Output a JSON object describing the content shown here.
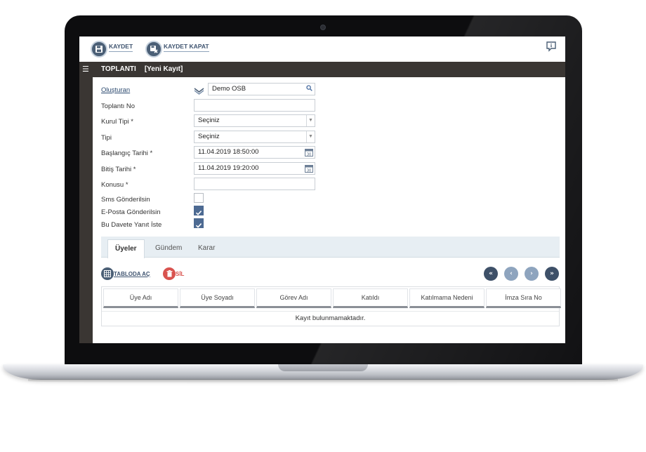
{
  "toolbar": {
    "save_label": "KAYDET",
    "save_close_label": "KAYDET KAPAT"
  },
  "title": {
    "main": "TOPLANTI",
    "sub": "[Yeni Kayıt]"
  },
  "form": {
    "olusturan_label": "Oluşturan",
    "olusturan_value": "Demo OSB",
    "toplanti_no_label": "Toplantı No",
    "toplanti_no_value": "",
    "kurul_tipi_label": "Kurul Tipi *",
    "kurul_tipi_value": "Seçiniz",
    "tipi_label": "Tipi",
    "tipi_value": "Seçiniz",
    "baslangic_label": "Başlangıç Tarihi *",
    "baslangic_value": "11.04.2019 18:50:00",
    "bitis_label": "Bitiş Tarihi *",
    "bitis_value": "11.04.2019 19:20:00",
    "konusu_label": "Konusu *",
    "konusu_value": "",
    "sms_label": "Sms Gönderilsin",
    "sms_checked": false,
    "eposta_label": "E-Posta Gönderilsin",
    "eposta_checked": true,
    "yanit_label": "Bu Davete Yanıt İste",
    "yanit_checked": true
  },
  "tabs": [
    {
      "label": "Üyeler",
      "active": true
    },
    {
      "label": "Gündem",
      "active": false
    },
    {
      "label": "Karar",
      "active": false
    }
  ],
  "subtoolbar": {
    "open_table_label": "TABLODA AÇ",
    "delete_label": "SİL"
  },
  "pager": {
    "first": "«",
    "prev": "‹",
    "next": "›",
    "last": "»"
  },
  "grid": {
    "columns": [
      "Üye Adı",
      "Üye Soyadı",
      "Görev Adı",
      "Katıldı",
      "Katılmama Nedeni",
      "İmza Sıra No"
    ],
    "empty_text": "Kayıt bulunmamaktadır."
  },
  "colors": {
    "accent": "#4b5f76",
    "titlebar": "#3a3633",
    "delete": "#d9534f",
    "checkbox_on": "#4d6a92"
  },
  "icons": {
    "save": "floppy-icon",
    "save_close": "floppy-close-icon",
    "help": "help-chat-icon",
    "menu": "hamburger-icon",
    "search": "search-icon",
    "calendar": "calendar-icon",
    "table": "table-icon",
    "delete": "trash-icon"
  }
}
